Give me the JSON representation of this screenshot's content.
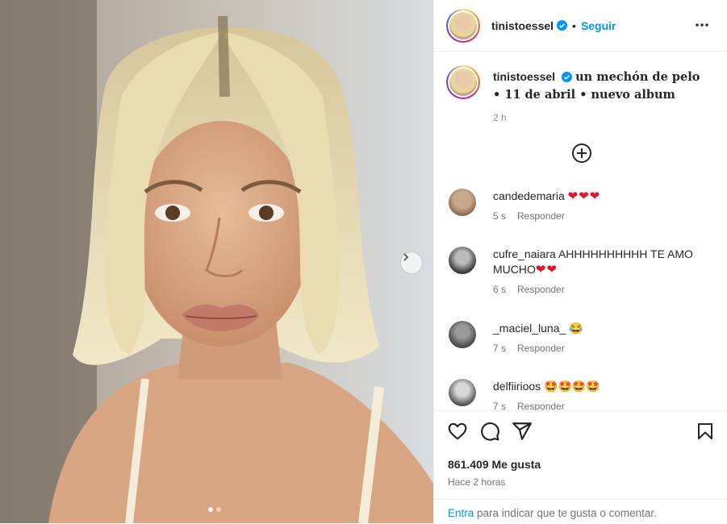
{
  "post": {
    "username": "tinistoessel",
    "follow_label": "Seguir",
    "separator": "•",
    "caption": "un mechón de pelo • 11 de abril • nuevo album",
    "caption_time": "2 h"
  },
  "comments": [
    {
      "user": "candedemaria",
      "text": "",
      "emoji": "❤❤❤",
      "time": "5 s",
      "reply": "Responder"
    },
    {
      "user": "cufre_naiara",
      "text": "AHHHHHHHHHH TE AMO MUCHO",
      "emoji": "❤❤",
      "time": "6 s",
      "reply": "Responder"
    },
    {
      "user": "_maciel_luna_",
      "text": "",
      "emoji": "😂",
      "time": "7 s",
      "reply": "Responder"
    },
    {
      "user": "delfiirioos",
      "text": "",
      "emoji": "🤩🤩🤩🤩",
      "time": "7 s",
      "reply": "Responder"
    }
  ],
  "engagement": {
    "likes": "861.409 Me gusta",
    "posted_ago": "Hace 2 horas"
  },
  "login_prompt": {
    "link": "Entra",
    "text": " para indicar que te gusta o comentar."
  },
  "carousel": {
    "slides": 2,
    "active": 1
  },
  "colors": {
    "accent": "#0095f6",
    "heart": "#e0152a",
    "verified": "#0095f6"
  },
  "icons": [
    "verified-icon",
    "more-options-icon",
    "add-comment-icon",
    "like-icon",
    "comment-icon",
    "share-icon",
    "save-icon",
    "chevron-right-icon"
  ]
}
